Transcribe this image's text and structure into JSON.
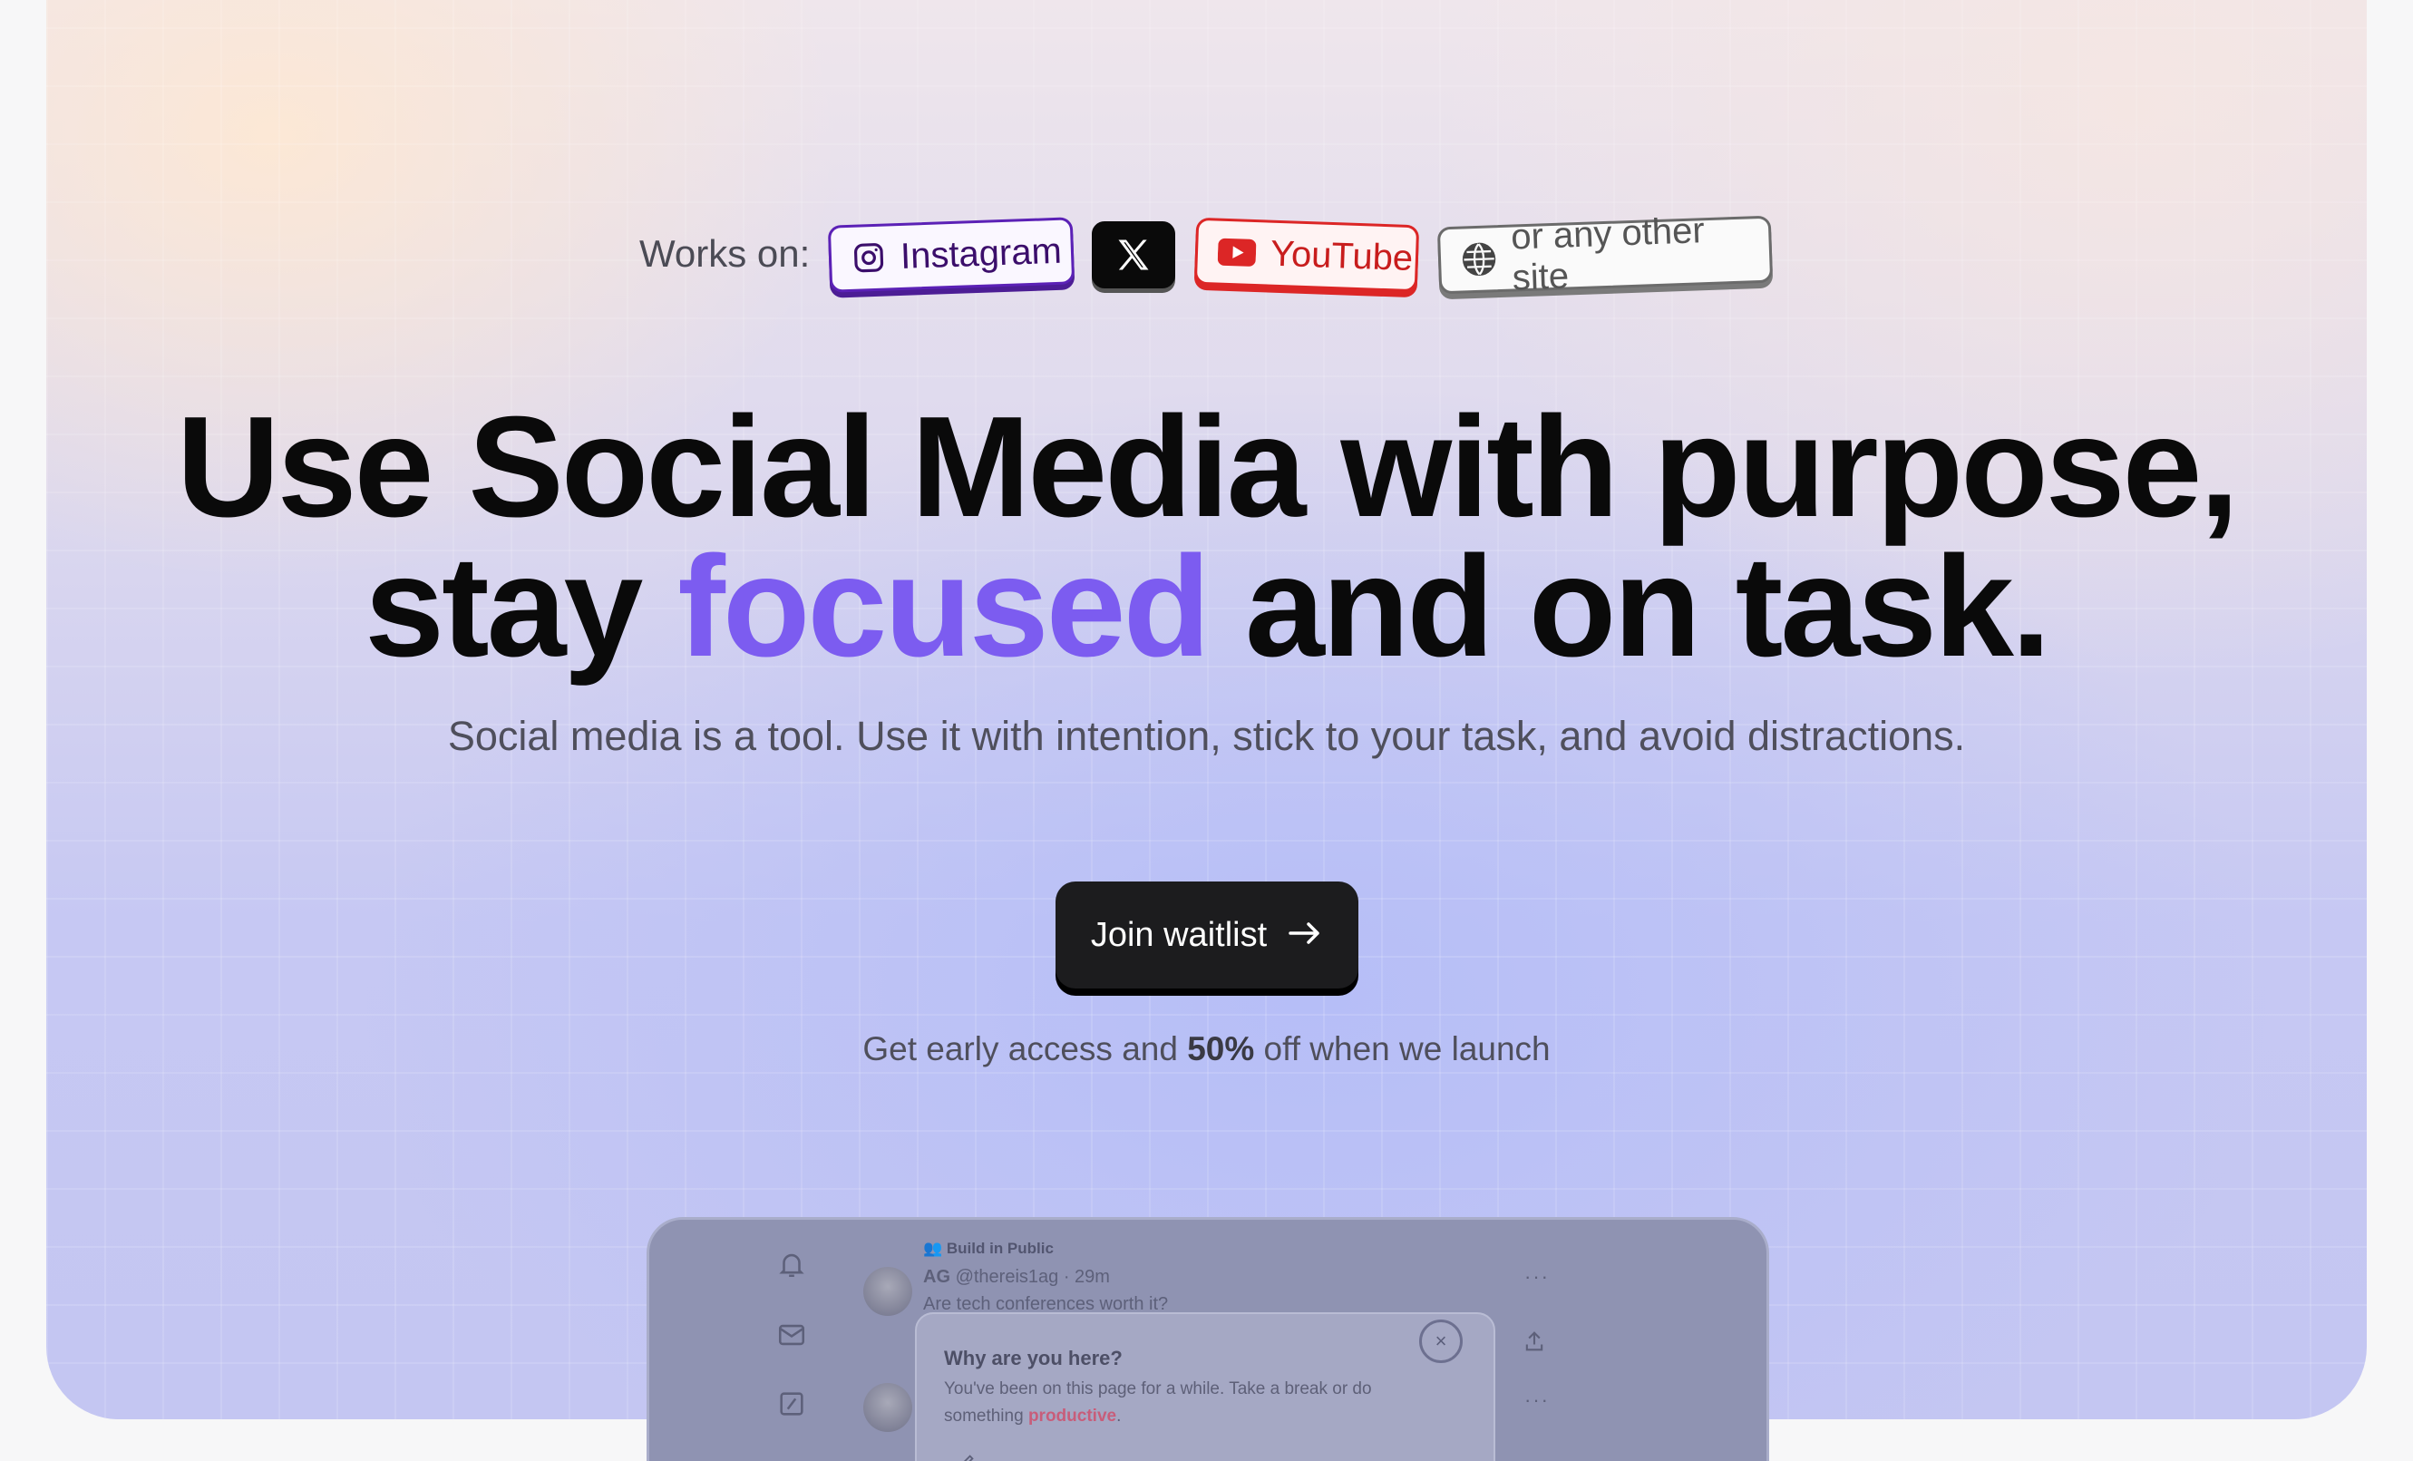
{
  "works_on": {
    "label": "Works on:",
    "chips": [
      {
        "label": "Instagram",
        "icon": "instagram-icon"
      },
      {
        "label": "",
        "icon": "x-logo-icon"
      },
      {
        "label": "YouTube",
        "icon": "youtube-icon"
      },
      {
        "label": "or any other site",
        "icon": "globe-icon"
      }
    ]
  },
  "headline": {
    "line1": "Use Social Media with purpose,",
    "line2_start": "stay ",
    "line2_accent": "focused",
    "line2_end": " and on task."
  },
  "subtitle": "Social media is a tool. Use it with intention, stick to your task, and avoid distractions.",
  "cta": {
    "label": "Join waitlist",
    "icon": "arrow-right-icon"
  },
  "note": {
    "before": "Get early access and ",
    "bold": "50%",
    "after": " off when we launch"
  },
  "preview": {
    "community": "Build in Public",
    "author": "AG",
    "handle": "@thereis1ag · 29m",
    "post": "Are tech conferences worth it?",
    "modal": {
      "title": "Why are you here?",
      "body_start": "You've been on this page for a while. Take a break or do something ",
      "body_highlight": "productive",
      "body_end": ".",
      "close": "×"
    },
    "more_label": "···"
  },
  "colors": {
    "accent": "#7c5cf0",
    "cta_bg": "#1c1c1e",
    "instagram": "#5b21b6",
    "youtube": "#dc2626"
  }
}
